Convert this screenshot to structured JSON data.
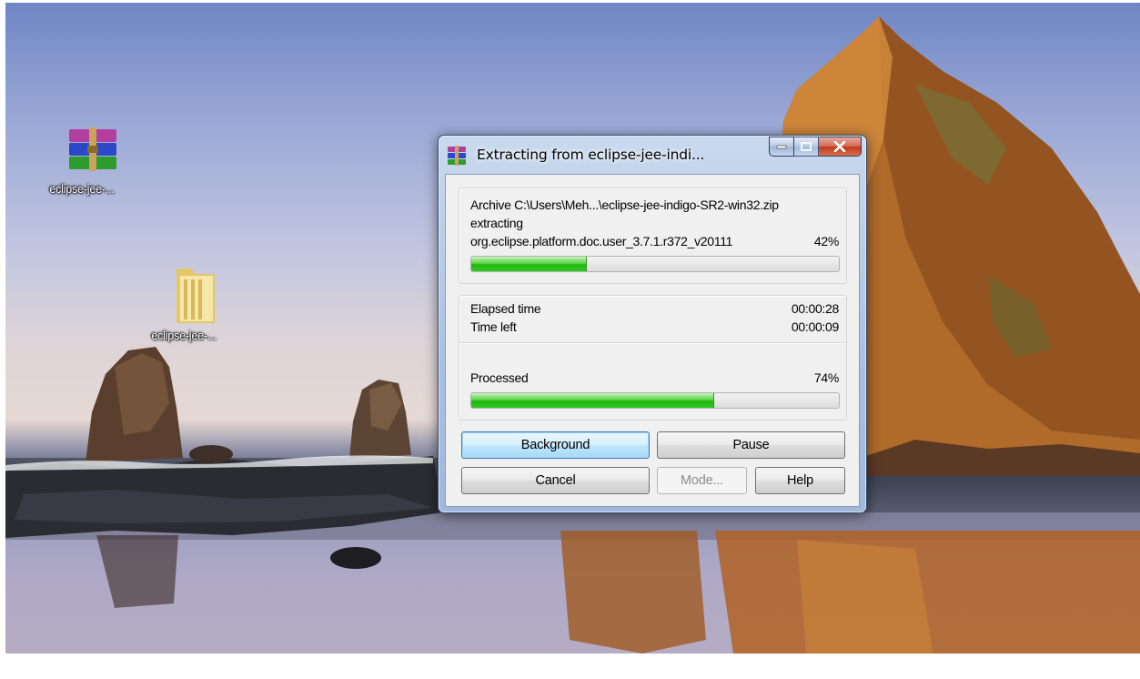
{
  "desktop": {
    "icons": [
      {
        "label": "eclipse-jee-...",
        "icon": "winrar-archive-icon"
      },
      {
        "label": "eclipse-jee-...",
        "icon": "folder-icon"
      }
    ]
  },
  "dialog": {
    "title": "Extracting from eclipse-jee-indi...",
    "title_icon": "winrar-icon",
    "caption_buttons": {
      "minimize": "minimize-icon",
      "maximize": "maximize-icon",
      "close": "close-icon"
    },
    "archive_line": "Archive C:\\Users\\Meh...\\eclipse-jee-indigo-SR2-win32.zip",
    "action": "extracting",
    "current_file": "org.eclipse.platform.doc.user_3.7.1.r372_v20111",
    "file_percent_label": "42%",
    "file_progress": 0.315,
    "elapsed_label": "Elapsed time",
    "elapsed_value": "00:00:28",
    "time_left_label": "Time left",
    "time_left_value": "00:00:09",
    "processed_label": "Processed",
    "processed_percent_label": "74%",
    "processed_progress": 0.66,
    "buttons": {
      "background": "Background",
      "pause": "Pause",
      "cancel": "Cancel",
      "mode": "Mode...",
      "help": "Help"
    }
  },
  "colors": {
    "progress_fill": "#20b70f",
    "close_button": "#c0381c",
    "default_button_border": "#3c7fb1"
  }
}
